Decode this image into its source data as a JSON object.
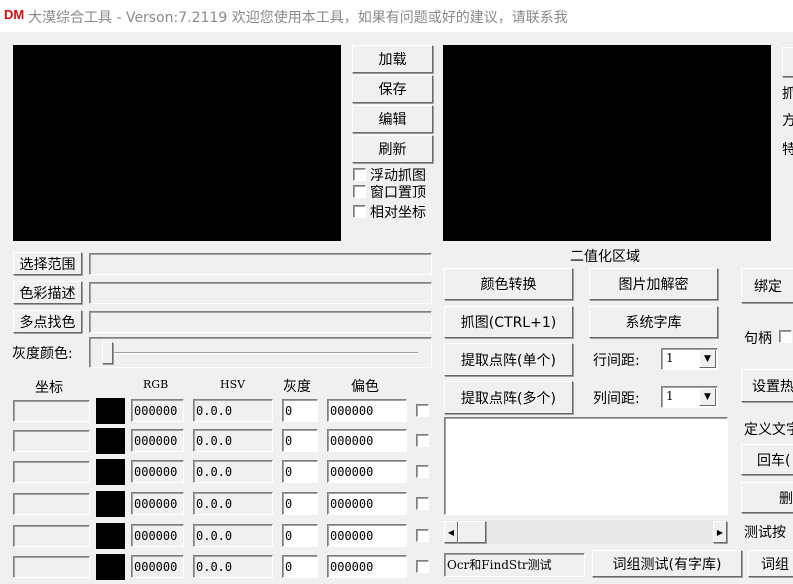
{
  "window": {
    "logo": "DM",
    "title": "大漠综合工具 -  Verson:7.2119  欢迎您使用本工具，如果有问题或好的建议，请联系我"
  },
  "top_buttons": {
    "load": "加载",
    "save": "保存",
    "edit": "编辑",
    "refresh": "刷新"
  },
  "checkboxes": {
    "float_capture": "浮动抓图",
    "window_top": "窗口置顶",
    "relative_coords": "相对坐标"
  },
  "binarize_label": "二值化区域",
  "left_controls": {
    "select_range": "选择范围",
    "color_desc": "色彩描述",
    "multi_point": "多点找色",
    "gray_color": "灰度颜色:"
  },
  "table": {
    "headers": {
      "coord": "坐标",
      "rgb": "RGB",
      "hsv": "HSV",
      "gray": "灰度",
      "bias": "偏色"
    },
    "rows": [
      {
        "coord": "",
        "rgb": "000000",
        "hsv": "0.0.0",
        "gray": "0",
        "bias": "000000"
      },
      {
        "coord": "",
        "rgb": "000000",
        "hsv": "0.0.0",
        "gray": "0",
        "bias": "000000"
      },
      {
        "coord": "",
        "rgb": "000000",
        "hsv": "0.0.0",
        "gray": "0",
        "bias": "000000"
      },
      {
        "coord": "",
        "rgb": "000000",
        "hsv": "0.0.0",
        "gray": "0",
        "bias": "000000"
      },
      {
        "coord": "",
        "rgb": "000000",
        "hsv": "0.0.0",
        "gray": "0",
        "bias": "000000"
      },
      {
        "coord": "",
        "rgb": "000000",
        "hsv": "0.0.0",
        "gray": "0",
        "bias": "000000"
      }
    ]
  },
  "mid_buttons": {
    "color_convert": "颜色转换",
    "image_crypt": "图片加解密",
    "capture": "抓图(CTRL+1)",
    "system_font": "系统字库",
    "extract_single": "提取点阵(单个)",
    "extract_multi": "提取点阵(多个)"
  },
  "spacing": {
    "row_label": "行间距:",
    "row_value": "1",
    "col_label": "列间距:",
    "col_value": "1"
  },
  "bottom": {
    "ocr_value": "Ocr和FindStr测试",
    "phrase_test": "词组测试(有字库)",
    "phrase_partial": "词组"
  },
  "right_partial": {
    "grab": "抓",
    "square": "方",
    "special": "特",
    "bind": "绑定",
    "handle": "句柄",
    "hotkey": "设置热",
    "define_text": "定义文字",
    "enter": "回车(",
    "delete": "删",
    "test_key": "测试按"
  }
}
